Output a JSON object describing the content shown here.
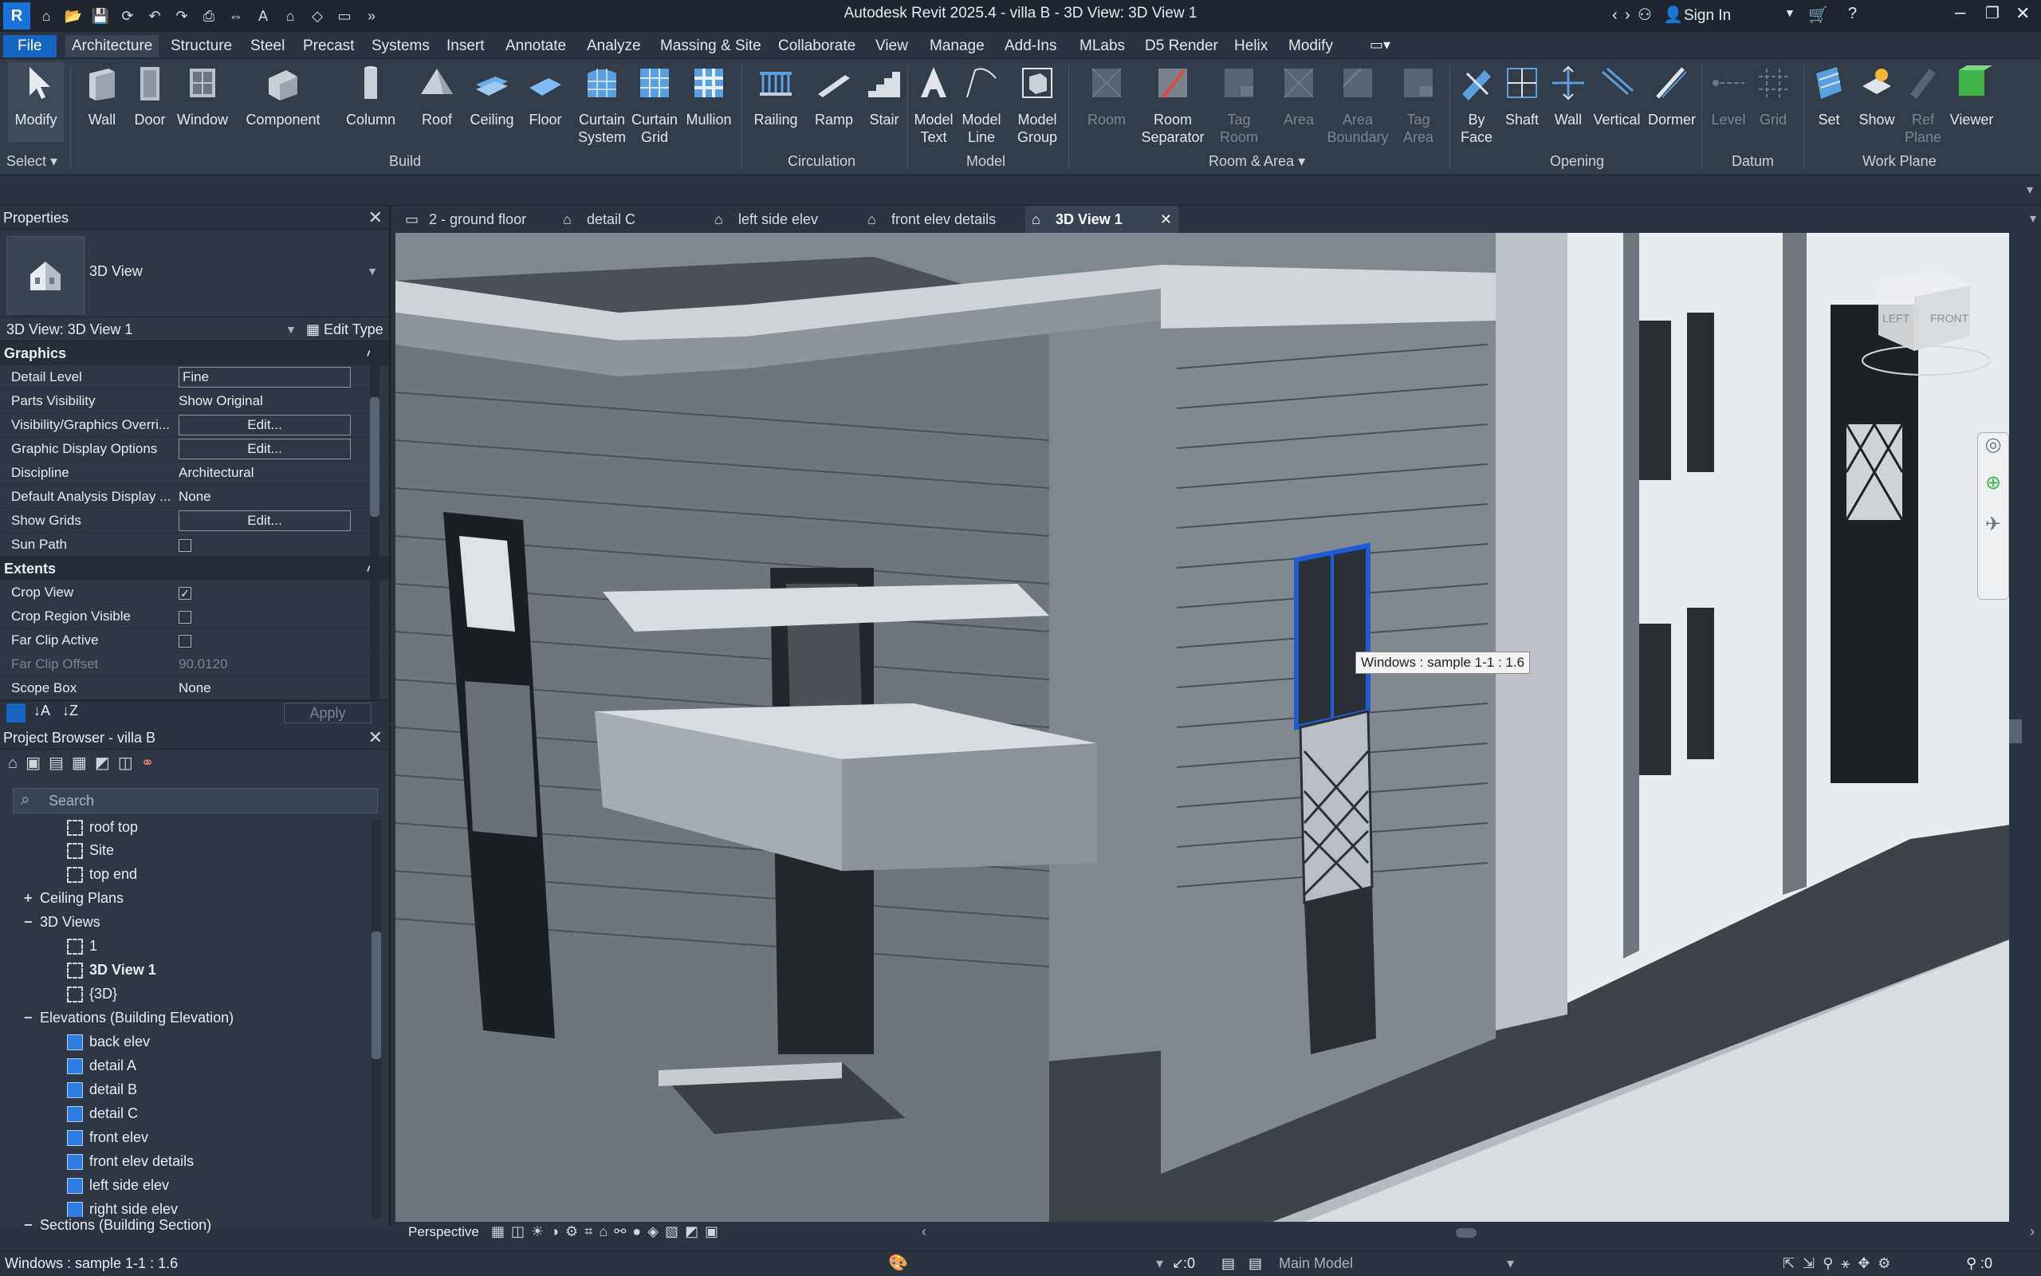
{
  "window": {
    "title": "Autodesk Revit 2025.4 - villa B - 3D View: 3D View 1",
    "sign_in": "Sign In"
  },
  "menu": {
    "tabs": [
      "File",
      "Architecture",
      "Structure",
      "Steel",
      "Precast",
      "Systems",
      "Insert",
      "Annotate",
      "Analyze",
      "Massing & Site",
      "Collaborate",
      "View",
      "Manage",
      "Add-Ins",
      "MLabs",
      "D5 Render",
      "Helix",
      "Modify"
    ],
    "active": "Architecture"
  },
  "ribbon": {
    "select": {
      "modify": "Modify",
      "panel": "Select"
    },
    "build": {
      "buttons": [
        "Wall",
        "Door",
        "Window",
        "Component",
        "Column",
        "Roof",
        "Ceiling",
        "Floor",
        "Curtain System",
        "Curtain Grid",
        "Mullion"
      ],
      "panel": "Build"
    },
    "circulation": {
      "buttons": [
        "Railing",
        "Ramp",
        "Stair"
      ],
      "panel": "Circulation"
    },
    "model": {
      "buttons": [
        "Model Text",
        "Model Line",
        "Model Group"
      ],
      "panel": "Model"
    },
    "room_area": {
      "buttons": [
        "Room",
        "Room Separator",
        "Tag Room",
        "Area",
        "Area Boundary",
        "Tag Area"
      ],
      "panel": "Room & Area"
    },
    "opening": {
      "buttons": [
        "By Face",
        "Shaft",
        "Wall",
        "Vertical",
        "Dormer"
      ],
      "panel": "Opening"
    },
    "datum": {
      "buttons": [
        "Level",
        "Grid"
      ],
      "panel": "Datum"
    },
    "workplane": {
      "buttons": [
        "Set",
        "Show",
        "Ref Plane",
        "Viewer"
      ],
      "panel": "Work Plane"
    }
  },
  "properties": {
    "title": "Properties",
    "type_name": "3D View",
    "instance": "3D View: 3D View 1",
    "edit_type": "Edit Type",
    "graphics_header": "Graphics",
    "graphics": [
      {
        "k": "Detail Level",
        "v": "Fine"
      },
      {
        "k": "Parts Visibility",
        "v": "Show Original"
      },
      {
        "k": "Visibility/Graphics Overri...",
        "v": "Edit..."
      },
      {
        "k": "Graphic Display Options",
        "v": "Edit..."
      },
      {
        "k": "Discipline",
        "v": "Architectural"
      },
      {
        "k": "Default Analysis Display ...",
        "v": "None"
      },
      {
        "k": "Show Grids",
        "v": "Edit..."
      },
      {
        "k": "Sun Path",
        "v": ""
      }
    ],
    "extents_header": "Extents",
    "extents": [
      {
        "k": "Crop View",
        "v": "checked"
      },
      {
        "k": "Crop Region Visible",
        "v": ""
      },
      {
        "k": "Far Clip Active",
        "v": ""
      },
      {
        "k": "Far Clip Offset",
        "v": "90.0120"
      },
      {
        "k": "Scope Box",
        "v": "None"
      }
    ],
    "apply": "Apply"
  },
  "browser": {
    "title": "Project Browser - villa B",
    "search_placeholder": "Search",
    "items": [
      {
        "label": "roof top",
        "level": 2,
        "icon": "plan"
      },
      {
        "label": "Site",
        "level": 2,
        "icon": "plan"
      },
      {
        "label": "top end",
        "level": 2,
        "icon": "plan"
      },
      {
        "label": "Ceiling Plans",
        "level": 1,
        "exp": "+"
      },
      {
        "label": "3D Views",
        "level": 1,
        "exp": "−"
      },
      {
        "label": "1",
        "level": 2,
        "icon": "plan"
      },
      {
        "label": "3D View 1",
        "level": 2,
        "icon": "plan",
        "bold": true
      },
      {
        "label": "{3D}",
        "level": 2,
        "icon": "plan"
      },
      {
        "label": "Elevations (Building Elevation)",
        "level": 1,
        "exp": "−"
      },
      {
        "label": "back elev",
        "level": 2,
        "icon": "elev"
      },
      {
        "label": "detail A",
        "level": 2,
        "icon": "elev"
      },
      {
        "label": "detail B",
        "level": 2,
        "icon": "elev"
      },
      {
        "label": "detail C",
        "level": 2,
        "icon": "elev"
      },
      {
        "label": "front elev",
        "level": 2,
        "icon": "elev"
      },
      {
        "label": "front elev details",
        "level": 2,
        "icon": "elev"
      },
      {
        "label": "left side elev",
        "level": 2,
        "icon": "elev"
      },
      {
        "label": "right side elev",
        "level": 2,
        "icon": "elev"
      },
      {
        "label": "Sections (Building Section)",
        "level": 1,
        "exp": "−"
      }
    ]
  },
  "view_tabs": [
    {
      "label": "2 - ground floor"
    },
    {
      "label": "detail C"
    },
    {
      "label": "left side elev"
    },
    {
      "label": "front elev details"
    },
    {
      "label": "3D View 1",
      "active": true
    }
  ],
  "viewport": {
    "tooltip": "Windows : sample 1-1 : 1.6",
    "viewcube_left": "LEFT",
    "viewcube_front": "FRONT"
  },
  "view_control": {
    "mode": "Perspective"
  },
  "status": {
    "message": "Windows : sample 1-1 : 1.6",
    "selection_count": ":0",
    "model": "Main Model",
    "filter_count": ":0"
  },
  "colors": {
    "accent": "#1565c0",
    "selection": "#1e5bd6",
    "panel_bg": "#2f3744"
  }
}
